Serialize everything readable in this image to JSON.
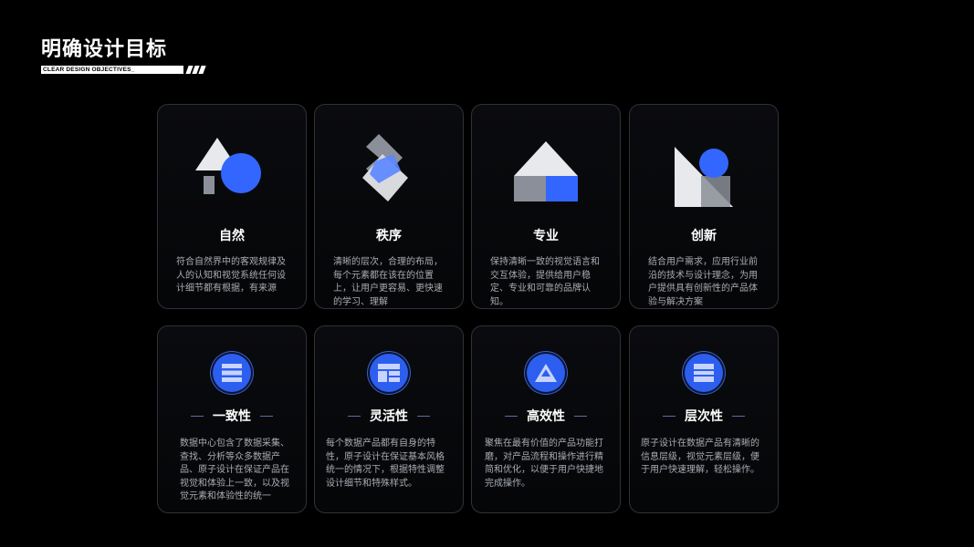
{
  "header": {
    "title": "明确设计目标",
    "subtitle": "CLEAR DESIGN OBJECTIVES_"
  },
  "colors": {
    "accent": "#3366ff",
    "background": "#000000",
    "card_border": "#2f3238",
    "text_secondary": "#a9acb3"
  },
  "top_cards": [
    {
      "title": "自然",
      "icon": "nature-shapes-icon",
      "desc": "符合自然界中的客观规律及人的认知和视觉系统任何设计细节都有根据，有来源"
    },
    {
      "title": "秩序",
      "icon": "order-shapes-icon",
      "desc": "清晰的层次，合理的布局，每个元素都在该在的位置上，让用户更容易、更快速的学习、理解"
    },
    {
      "title": "专业",
      "icon": "professional-house-icon",
      "desc": "保持清晰一致的视觉语言和交互体验，提供给用户稳定、专业和可靠的品牌认知。"
    },
    {
      "title": "创新",
      "icon": "innovation-shapes-icon",
      "desc": "结合用户需求，应用行业前沿的技术与设计理念，为用户提供具有创新性的产品体验与解决方案"
    }
  ],
  "bottom_cards": [
    {
      "title": "一致性",
      "icon": "list-lines-icon",
      "desc": "数据中心包含了数据采集、查找、分析等众多数据产品、原子设计在保证产品在视觉和体验上一致，以及视觉元素和体验性的统一"
    },
    {
      "title": "灵活性",
      "icon": "layout-blocks-icon",
      "desc": "每个数据产品都有自身的特性，原子设计在保证基本风格统一的情况下，根据特性调整设计细节和特殊样式。"
    },
    {
      "title": "高效性",
      "icon": "triangle-stack-icon",
      "desc": "聚焦在最有价值的产品功能打磨，对产品流程和操作进行精简和优化，以便于用户快捷地完成操作。"
    },
    {
      "title": "层次性",
      "icon": "layered-bars-icon",
      "desc": "原子设计在数据产品有清晰的信息层级，视觉元素层级，便于用户快速理解，轻松操作。"
    }
  ]
}
